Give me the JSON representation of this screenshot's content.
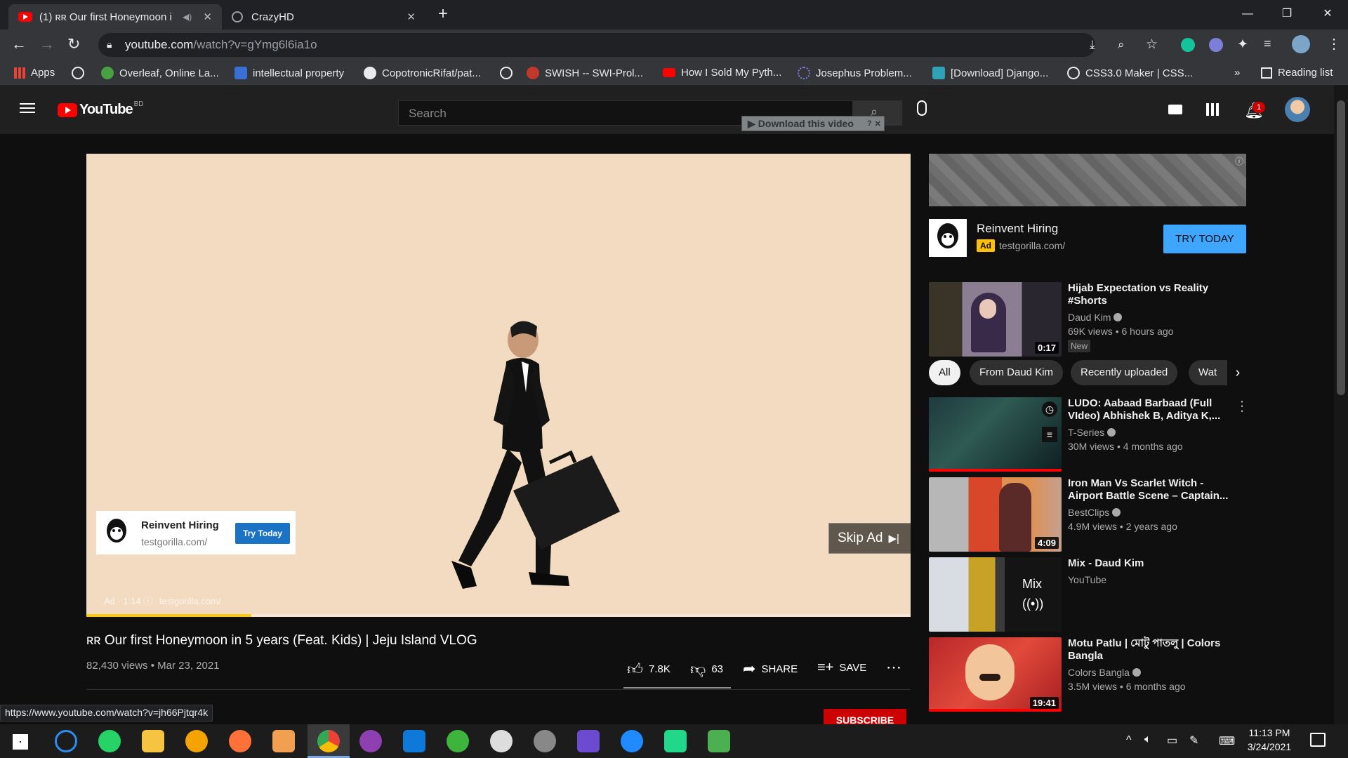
{
  "browser": {
    "tabs": [
      {
        "title": "(1) ʀʀ Our first Honeymoon i",
        "active": true
      },
      {
        "title": "CrazyHD",
        "active": false
      }
    ],
    "url_host": "youtube.com",
    "url_path": "/watch?v=gYmg6l6ia1o",
    "bookmarks": [
      "Apps",
      "Overleaf, Online La...",
      "intellectual property",
      "CopotronicRifat/pat...",
      "SWISH -- SWI-Prol...",
      "How I Sold My Pyth...",
      "Josephus Problem...",
      "[Download] Django...",
      "CSS3.0 Maker | CSS...",
      "Reading list"
    ],
    "bookmarks_more": "»",
    "status_url": "https://www.youtube.com/watch?v=jh66Pjtqr4k"
  },
  "youtube": {
    "logo_text": "YouTube",
    "logo_region": "BD",
    "search_placeholder": "Search",
    "download_bar": "Download this video",
    "notif_count": "1"
  },
  "player": {
    "ad_overlay": {
      "title": "Reinvent Hiring",
      "url": "testgorilla.com/",
      "cta": "Try Today"
    },
    "skip_ad": "Skip Ad",
    "ad_info": "Ad · 1:14",
    "ad_url": "testgorilla.com/",
    "progress": 0.2
  },
  "video": {
    "title": "ʀʀ Our first Honeymoon in 5 years (Feat. Kids) | Jeju Island VLOG",
    "views": "82,430 views • Mar 23, 2021",
    "likes": "7.8K",
    "dislikes": "63",
    "share": "SHARE",
    "save": "SAVE",
    "subscribe": "SUBSCRIBE"
  },
  "sidebar_ad": {
    "title": "Reinvent Hiring",
    "badge": "Ad",
    "url": "testgorilla.com/",
    "cta": "TRY TODAY"
  },
  "chips": [
    "All",
    "From Daud Kim",
    "Recently uploaded",
    "Wat"
  ],
  "recommendations": [
    {
      "title": "Hijab Expectation vs Reality #Shorts",
      "channel": "Daud Kim",
      "meta": "69K views • 6 hours ago",
      "badge": "New",
      "duration": "0:17"
    },
    {
      "title": "LUDO: Aabaad Barbaad (Full VIdeo) Abhishek B, Aditya K,...",
      "channel": "T-Series",
      "meta": "30M views • 4 months ago",
      "duration": ""
    },
    {
      "title": "Iron Man Vs Scarlet Witch - Airport Battle Scene – Captain...",
      "channel": "BestClips",
      "meta": "4.9M views • 2 years ago",
      "duration": "4:09"
    },
    {
      "title": "Mix - Daud Kim",
      "channel": "YouTube",
      "meta": "",
      "duration": "",
      "mix_label": "Mix"
    },
    {
      "title": "Motu Patlu | মোটু পাতলু | Colors Bangla",
      "channel": "Colors Bangla",
      "meta": "3.5M views • 6 months ago",
      "duration": "19:41"
    }
  ],
  "taskbar": {
    "time": "11:13 PM",
    "date": "3/24/2021"
  }
}
